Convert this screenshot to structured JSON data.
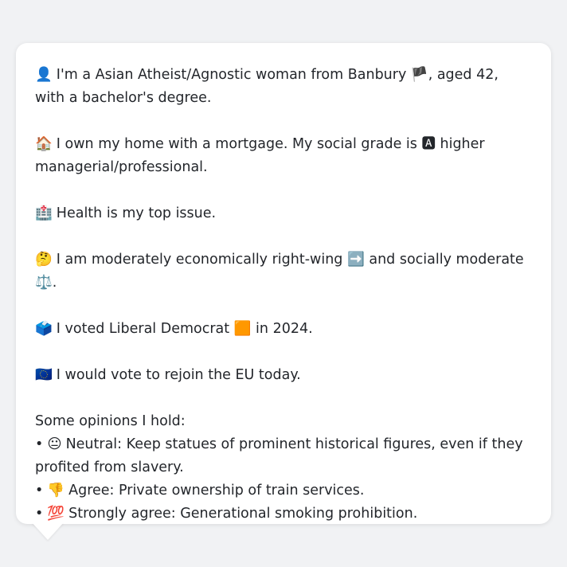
{
  "profile": {
    "intro": {
      "icon": "👤",
      "text_a": "I'm a Asian Atheist/Agnostic woman from Banbury ",
      "flag": "🏴",
      "text_b": ", aged 42, with a bachelor's degree."
    },
    "home": {
      "icon": "🏠",
      "text_a": "I own my home with a mortgage. My social grade is ",
      "grade_icon": "🅰",
      "text_b": " higher managerial/professional."
    },
    "issue": {
      "icon": "🏥",
      "text": "Health is my top issue."
    },
    "politics": {
      "icon": "🤔",
      "text_a": "I am moderately economically right-wing ",
      "right_icon": "➡️",
      "text_b": " and socially moderate ",
      "scale_icon": "⚖️",
      "text_c": "."
    },
    "vote": {
      "icon": "🗳️",
      "text_a": "I voted Liberal Democrat ",
      "party_icon": "🟧",
      "text_b": " in 2024."
    },
    "eu": {
      "icon": "🇪🇺",
      "text": "I would vote to rejoin the EU today."
    },
    "opinions": {
      "heading": "Some opinions I hold:",
      "items": [
        {
          "bullet": "•",
          "icon": "😐",
          "text": "Neutral: Keep statues of prominent historical figures, even if they profited from slavery."
        },
        {
          "bullet": "•",
          "icon": "👎",
          "text": "Agree: Private ownership of train services."
        },
        {
          "bullet": "•",
          "icon": "💯",
          "text": "Strongly agree: Generational smoking prohibition."
        }
      ]
    }
  }
}
